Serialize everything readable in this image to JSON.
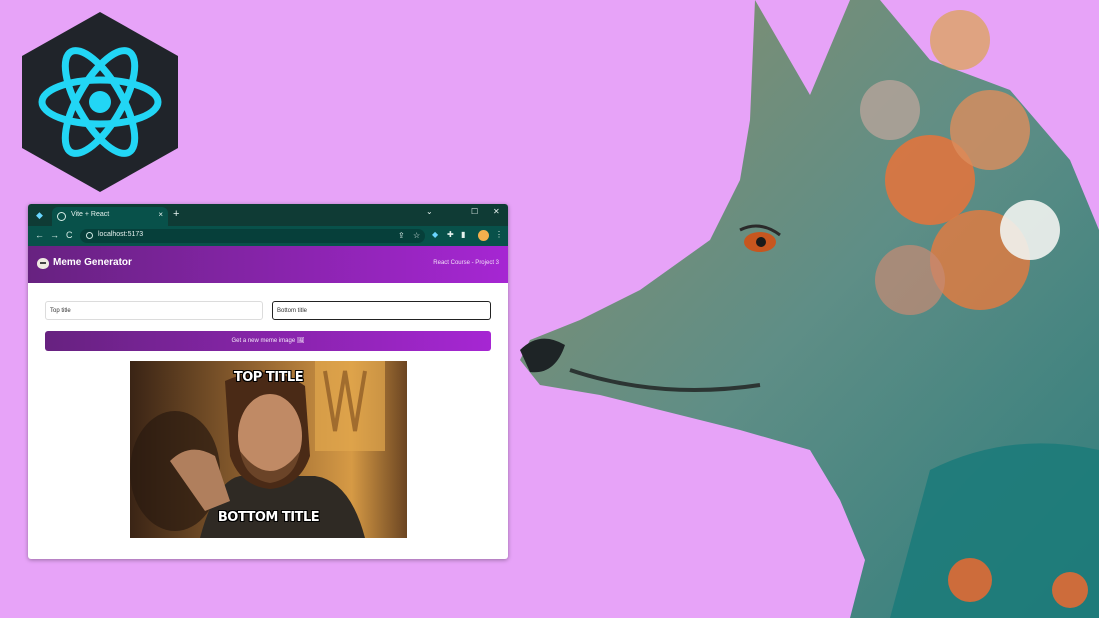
{
  "browser": {
    "tab_title": "Vite + React",
    "tab_close": "×",
    "new_tab": "+",
    "address": "localhost:5173",
    "window_controls": [
      "⌄",
      "☐",
      "✕"
    ],
    "nav_icons": [
      "←",
      "→",
      "C"
    ]
  },
  "app": {
    "title": "Meme Generator",
    "subtitle": "React Course - Project 3",
    "top_input_value": "Top title",
    "bottom_input_value": "Bottom title",
    "button_label": "Get a new meme image 🖼",
    "meme_top_text": "TOP TITLE",
    "meme_bottom_text": "BOTTOM TITLE"
  },
  "colors": {
    "background": "#e7a3f8",
    "browser_chrome": "#0f3b35",
    "accent_start": "#672280",
    "accent_end": "#a626d3",
    "react_cyan": "#22d6f5"
  },
  "icons": [
    "react-logo",
    "globe-icon",
    "lock-icon",
    "share-icon",
    "star-icon",
    "extension-icon",
    "puzzle-icon",
    "sidebar-icon",
    "profile-avatar",
    "menu-dots-icon",
    "troll-face-icon"
  ]
}
